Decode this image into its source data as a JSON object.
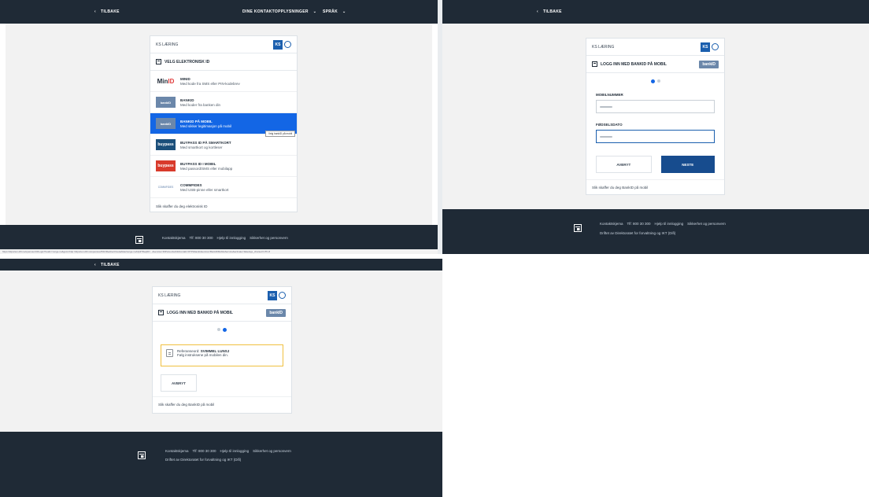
{
  "panel1": {
    "back": "TILBAKE",
    "nav_contact": "DINE KONTAKTOPPLYSNINGER",
    "nav_lang": "SPRÅK",
    "card_title": "KS LÆRING",
    "badge": "KS",
    "section_title": "VELG ELEKTRONISK ID",
    "items": [
      {
        "logo_a": "Min",
        "logo_b": "ID",
        "title": "MINID",
        "desc": "Med kode fra SMS eller PIN-kodebrev"
      },
      {
        "logo": "bankID",
        "title": "BANKID",
        "desc": "Med koder fra banken din"
      },
      {
        "logo": "bankID",
        "title": "BANKID PÅ MOBIL",
        "desc": "Med sikker legitimasjon på mobil"
      },
      {
        "logo": "buypass",
        "title": "BUYPASS ID PÅ SMARTKORT",
        "desc": "Med smartkort og kortleser"
      },
      {
        "logo": "buypass",
        "title": "BUYPASS ID I MOBIL",
        "desc": "Med passord/SMS eller mobilapp"
      },
      {
        "logo": "COMMFIDES",
        "title": "COMMFIDES",
        "desc": "Med USB-pinne eller smartkort"
      }
    ],
    "tooltip": "Velg bankID på mobil",
    "help_link": "Slik skaffer du deg elektronisk ID",
    "footer_links": [
      "Kontaktskjema",
      "Tlf: 800 30 300",
      "Hjelp til innlogging",
      "Sikkerhet og personvern"
    ],
    "url": "https://idporten.difi.no/opensso/UI/Login?realm=norge.no&goto=http://idporten.difi.no/opensso/SSORedirect/metaAlias/norge.no/idp3?ReqID=...&service=IDPortenAuth&fromtab=OTP&bankidservice=BankIDMobileService&activate=false&gx_charset=UTF-8"
  },
  "panel2": {
    "back": "TILBAKE",
    "card_title": "KS LÆRING",
    "badge": "KS",
    "section_title": "LOGG INN MED BANKID PÅ MOBIL",
    "bankid_badge": "bankID",
    "mobile_label": "MOBILNUMMER",
    "birth_label": "FØDSELSDATO",
    "cancel": "AVBRYT",
    "next": "NESTE",
    "help_link": "Slik skaffer du deg BankID på mobil",
    "footer_links": [
      "Kontaktskjema",
      "Tlf: 800 30 300",
      "Hjelp til innlogging",
      "Sikkerhet og personvern"
    ],
    "operated_prefix": "Driftet av",
    "operated_by": "Direktoratet for forvaltning og IKT (Difi)"
  },
  "panel3": {
    "back": "TILBAKE",
    "card_title": "KS LÆRING",
    "badge": "KS",
    "section_title": "LOGG INN MED BANKID PÅ MOBIL",
    "bankid_badge": "bankID",
    "ref_prefix": "Referanseord:",
    "ref_word": "SVIMMEL LUNSJ",
    "instruction": "Følg instruksene på mobilen din.",
    "cancel": "AVBRYT",
    "help_link": "Slik skaffer du deg BankID på mobil",
    "footer_links": [
      "Kontaktskjema",
      "Tlf: 800 30 300",
      "Hjelp til innlogging",
      "Sikkerhet og personvern"
    ],
    "operated_prefix": "Driftet av",
    "operated_by": "Direktoratet for forvaltning og IKT (Difi)"
  },
  "colors": {
    "navy": "#1f2a36",
    "primary": "#1366e5",
    "button": "#174c8e",
    "warning": "#f0c040"
  }
}
